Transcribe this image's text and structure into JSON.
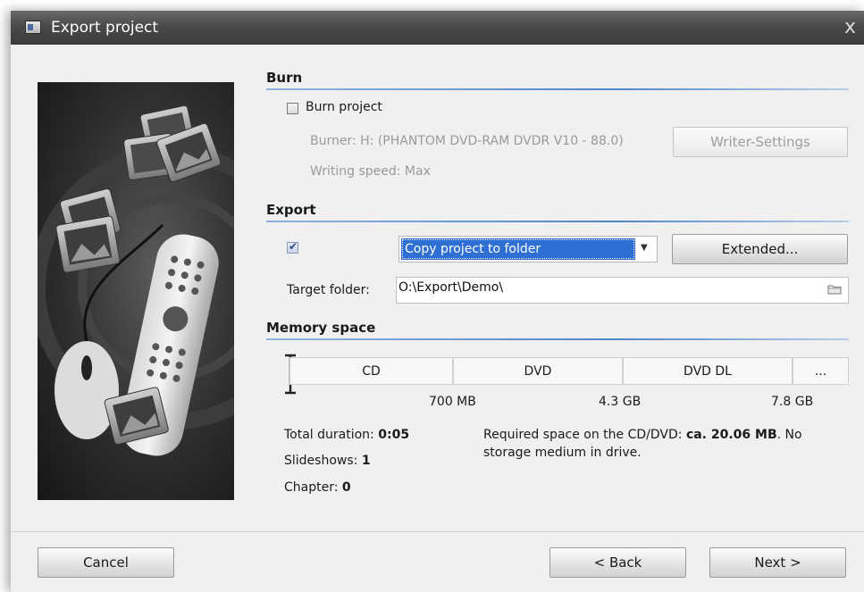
{
  "window": {
    "title": "Export project",
    "close_glyph": "x"
  },
  "burn": {
    "heading": "Burn",
    "checkbox_label": "Burn project",
    "burner_text": "Burner: H: (PHANTOM DVD-RAM DVDR V10 - 88.0)",
    "writing_speed": "Writing speed: Max",
    "writer_settings_button": "Writer-Settings"
  },
  "export": {
    "heading": "Export",
    "enabled": true,
    "mode_value": "Copy project to folder",
    "extended_button": "Extended...",
    "target_folder_label": "Target folder:",
    "target_folder_value": "O:\\Export\\Demo\\"
  },
  "memory": {
    "heading": "Memory space",
    "media": [
      "CD",
      "DVD",
      "DVD DL",
      "..."
    ],
    "sizes": [
      "700 MB",
      "4.3 GB",
      "7.8 GB"
    ],
    "total_duration_label": "Total duration: ",
    "total_duration_value": "0:05",
    "slideshows_label": "Slideshows: ",
    "slideshows_value": "1",
    "chapter_label": "Chapter: ",
    "chapter_value": "0",
    "required_prefix": "Required space on the CD/DVD: ",
    "required_value": "ca. 20.06 MB",
    "required_suffix": ". No",
    "required_line2": "storage medium in drive."
  },
  "footer": {
    "cancel_button": "Cancel",
    "back_button": "< Back",
    "next_button": "Next >"
  },
  "icons": [
    "window-app-icon",
    "close-icon",
    "folder-icon",
    "dropdown-arrow-icon",
    "checkmark-icon",
    "text-cursor-icon"
  ],
  "colors": {
    "accent": "#2f6fd3",
    "section_line": "#4f86c9",
    "titlebar": "#4a4a4a"
  }
}
